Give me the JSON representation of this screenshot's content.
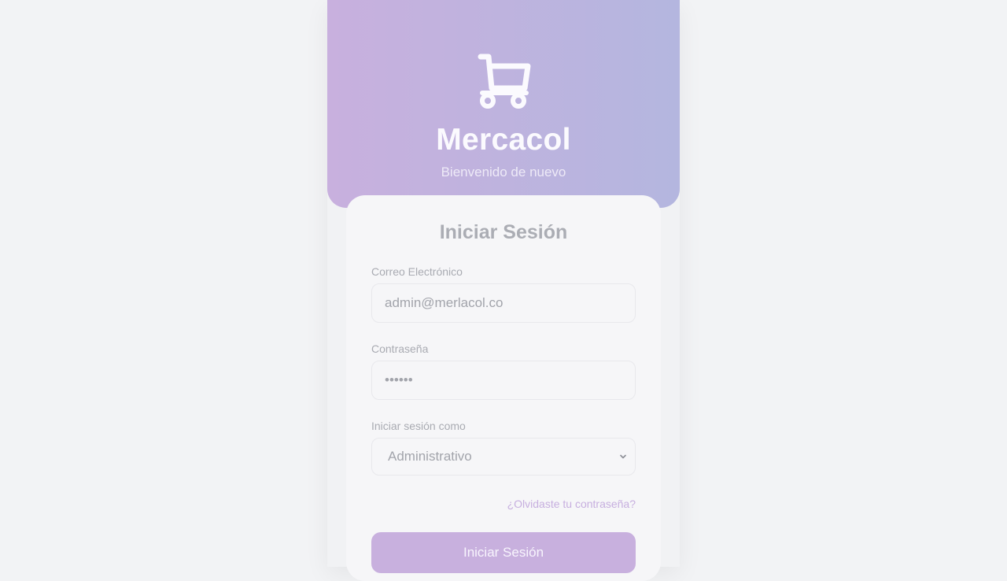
{
  "header": {
    "icon": "shopping-cart-icon",
    "brand": "Mercacol",
    "tagline": "Bienvenido de nuevo"
  },
  "login": {
    "title": "Iniciar Sesión",
    "email_label": "Correo Electrónico",
    "email_value": "admin@merlacol.co",
    "password_label": "Contraseña",
    "password_value": "••••••",
    "role_label": "Iniciar sesión como",
    "role_value": "Administrativo",
    "forgot_link": "¿Olvidaste tu contraseña?",
    "submit_label": "Iniciar Sesión"
  },
  "colors": {
    "header_start": "#c8b0de",
    "header_end": "#b4b6df",
    "accent": "#c8b0de",
    "page_background": "#f2f3f5"
  }
}
